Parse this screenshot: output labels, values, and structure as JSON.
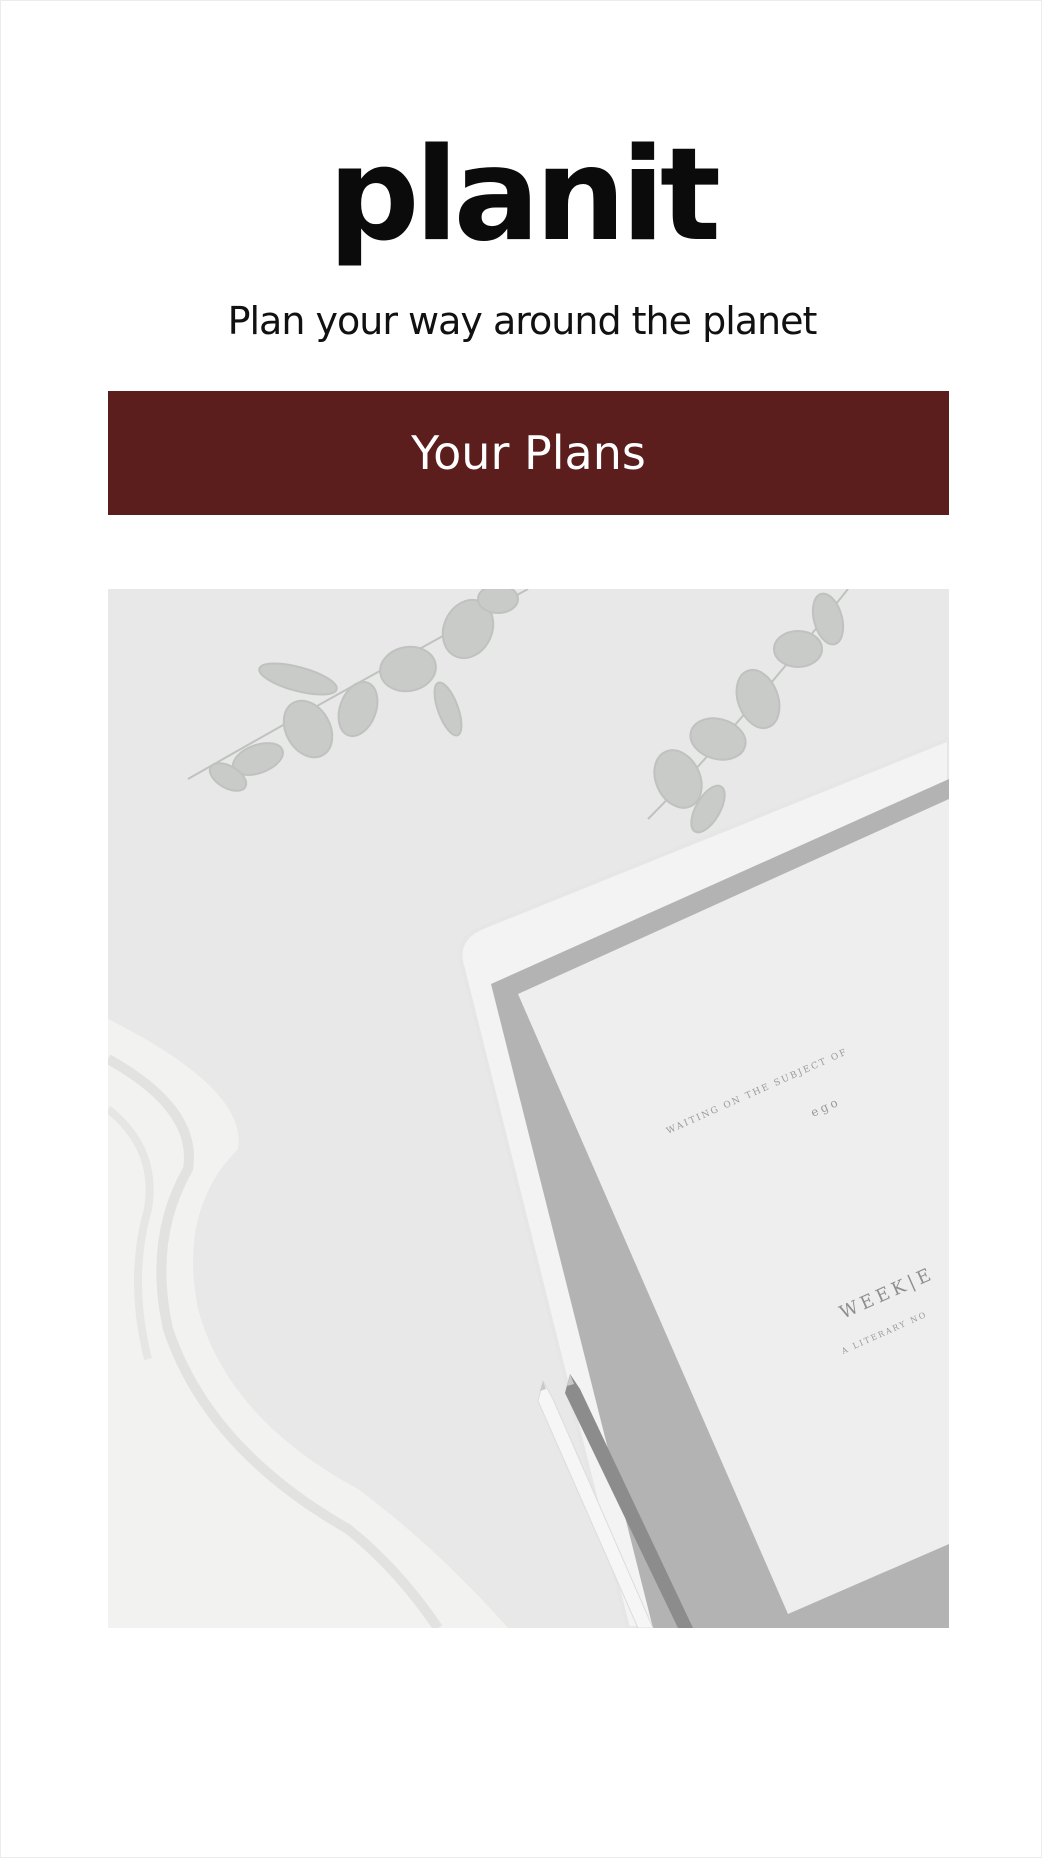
{
  "app": {
    "logo_text": "planit",
    "tagline": "Plan your way around the planet"
  },
  "actions": {
    "plans_button_label": "Your Plans"
  },
  "hero": {
    "description_icon": "planner-desk-photo",
    "tablet_text_line1": "WAITING ON THE SUBJECT OF",
    "tablet_text_line2": "ego",
    "tablet_text_line3": "WEEK|E",
    "tablet_text_line4": "A LITERARY NO"
  },
  "colors": {
    "brand": "#5c1d1d",
    "text": "#0b0b0b",
    "background": "#ffffff"
  }
}
